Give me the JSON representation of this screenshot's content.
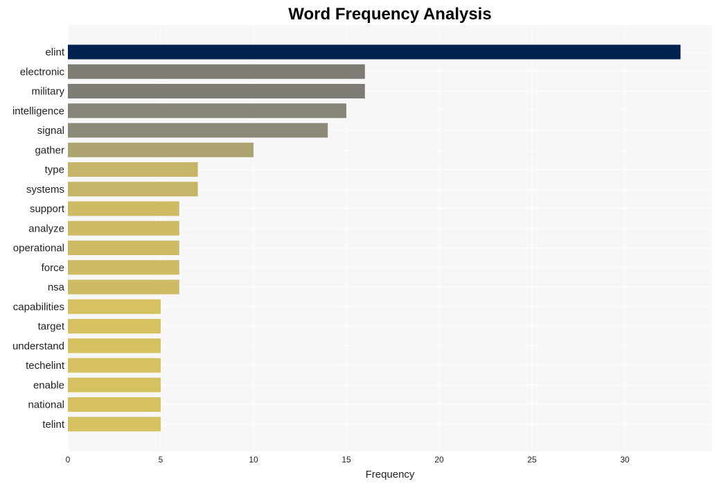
{
  "chart_data": {
    "type": "bar",
    "orientation": "horizontal",
    "title": "Word Frequency Analysis",
    "xlabel": "Frequency",
    "ylabel": "",
    "xlim": [
      0,
      34.7
    ],
    "xticks": [
      0,
      5,
      10,
      15,
      20,
      25,
      30
    ],
    "grid": true,
    "categories": [
      "elint",
      "electronic",
      "military",
      "intelligence",
      "signal",
      "gather",
      "type",
      "systems",
      "support",
      "analyze",
      "operational",
      "force",
      "nsa",
      "capabilities",
      "target",
      "understand",
      "techelint",
      "enable",
      "national",
      "telint"
    ],
    "values": [
      33,
      16,
      16,
      15,
      14,
      10,
      7,
      7,
      6,
      6,
      6,
      6,
      6,
      5,
      5,
      5,
      5,
      5,
      5,
      5
    ],
    "colors": [
      "#00224e",
      "#7f7c75",
      "#7f7c75",
      "#878479",
      "#8e8a7a",
      "#ada371",
      "#c6b569",
      "#c6b569",
      "#cfbb63",
      "#cfbb63",
      "#cfbb63",
      "#cfbb63",
      "#cfbb63",
      "#d6c160",
      "#d6c160",
      "#d6c160",
      "#d6c160",
      "#d6c160",
      "#d6c160",
      "#d6c160"
    ],
    "background": "#f7f7f7"
  }
}
